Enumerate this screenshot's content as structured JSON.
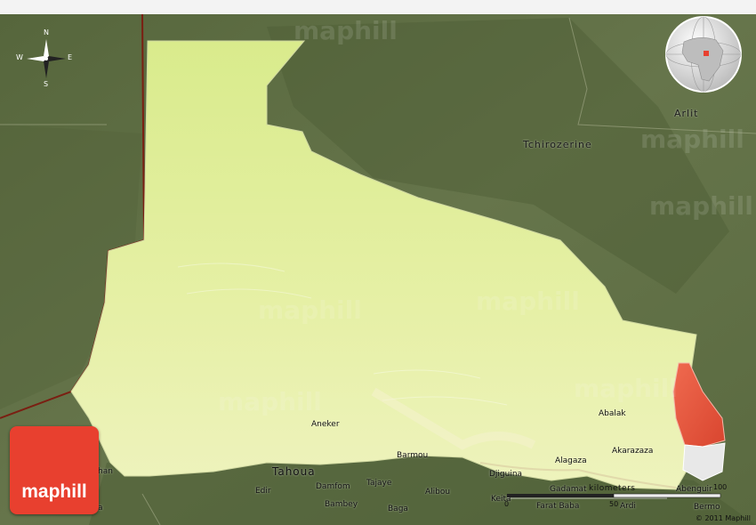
{
  "map": {
    "watermark_text": "maphill",
    "colors": {
      "terrain": "#5f6f44",
      "region_fill": "#e4ef9f",
      "neighbor_fill": "#e5553f",
      "border": "#7a1f12",
      "logo_bg": "#e8402f"
    }
  },
  "labels": {
    "arlit": "Arlit",
    "tchirozerine": "Tchirozerine",
    "aneker": "Aneker",
    "abalak": "Abalak",
    "akarazaza": "Akarazaza",
    "alagaza": "Alagaza",
    "tahoua": "Tahoua",
    "barmou": "Barmou",
    "djiguina": "Djiguina",
    "edir": "Edir",
    "damfom": "Damfom",
    "tajaye": "Tajaye",
    "alibou": "Alibou",
    "bambey": "Bambey",
    "baga": "Baga",
    "keita": "Keita",
    "farat_baba": "Farat Baba",
    "ardi": "Ardi",
    "gadamat": "Gadamat",
    "abenguir": "Abenguir",
    "bermo": "Bermo",
    "han": "han",
    "ta": "a"
  },
  "compass": {
    "n": "N",
    "s": "S",
    "e": "E",
    "w": "W"
  },
  "scale": {
    "unit": "kilometers",
    "ticks": [
      "0",
      "50",
      "100"
    ]
  },
  "logo": {
    "text": "maphill"
  },
  "copyright": "© 2011 Maphill"
}
